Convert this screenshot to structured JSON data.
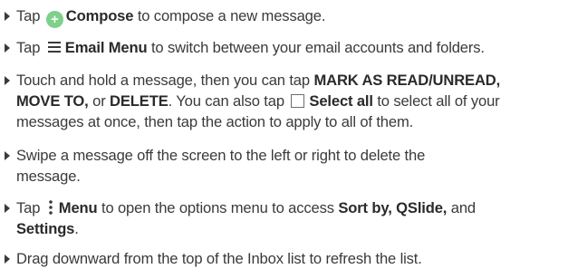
{
  "items": [
    {
      "lines": [
        {
          "t1": "Tap",
          "icon": "compose-plus-icon",
          "b1": "Compose",
          "t2": "to compose a new message."
        }
      ]
    },
    {
      "lines": [
        {
          "t1": "Tap",
          "icon": "hamburger-menu-icon",
          "b1": "Email Menu",
          "t2": "to switch between your email accounts and folders."
        }
      ]
    },
    {
      "lines": [
        {
          "t1": "Touch and hold a message, then you can tap",
          "b1": "MARK AS READ/UNREAD,"
        },
        {
          "b1": "MOVE TO,",
          "t1": "or",
          "b2": "DELETE",
          "t2": ". You can also tap",
          "icon": "checkbox-icon",
          "b3": "Select all",
          "t3": "to select all of your"
        },
        {
          "t1": "messages at once, then tap the action to apply to all of them."
        }
      ]
    },
    {
      "lines": [
        {
          "t1": "Swipe a message off the screen to the left or right to delete the"
        },
        {
          "t1": "message."
        }
      ]
    },
    {
      "lines": [
        {
          "t1": "Tap",
          "icon": "vertical-dots-menu-icon",
          "b1": "Menu",
          "t2": "to open the options menu to access",
          "b2": "Sort by, QSlide,",
          "t3": "and"
        },
        {
          "b1": "Settings",
          "t1": "."
        }
      ]
    },
    {
      "lines": [
        {
          "t1": "Drag downward from the top of the Inbox list to refresh the list."
        }
      ]
    }
  ],
  "colors": {
    "text": "#3a3a3a",
    "compose_icon": "#7ed08a"
  }
}
